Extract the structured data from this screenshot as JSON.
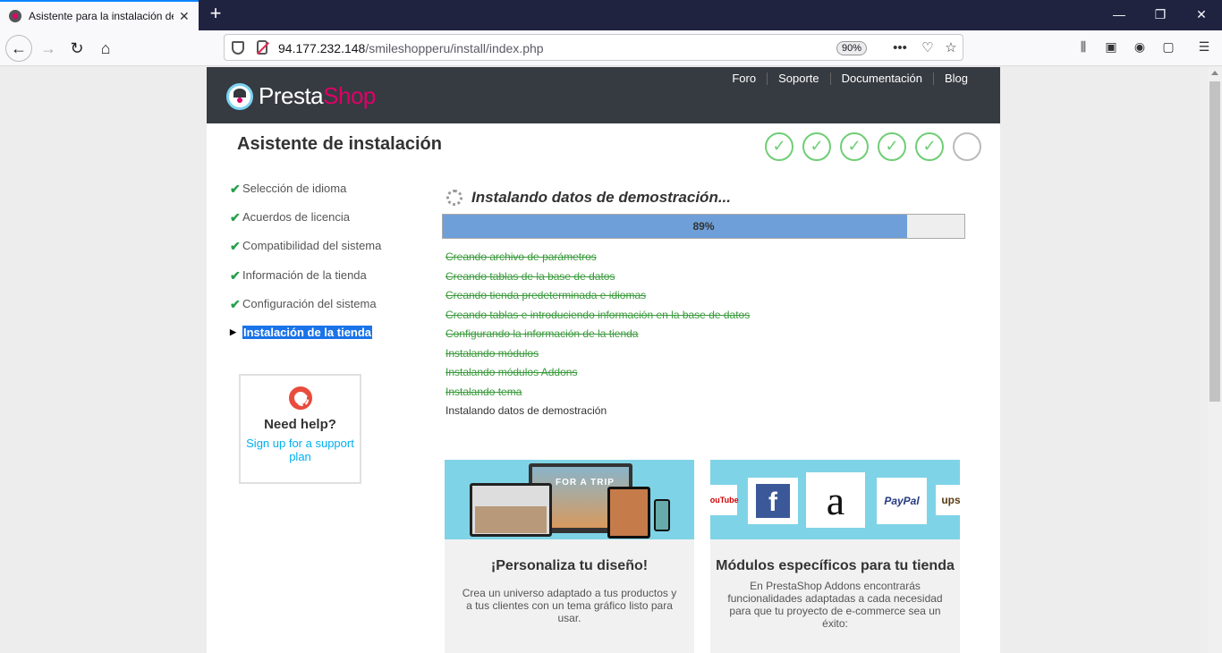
{
  "browser": {
    "tab_title": "Asistente para la instalación de",
    "url_host": "94.177.232.148",
    "url_path": "/smileshopperu/install/index.php",
    "zoom": "90%"
  },
  "header": {
    "logo_presta": "Presta",
    "logo_shop": "Shop",
    "nav": [
      "Foro",
      "Soporte",
      "Documentación",
      "Blog"
    ]
  },
  "wizard": {
    "title": "Asistente de instalación",
    "steps": [
      {
        "label": "Selección de idioma",
        "status": "done"
      },
      {
        "label": "Acuerdos de licencia",
        "status": "done"
      },
      {
        "label": "Compatibilidad del sistema",
        "status": "done"
      },
      {
        "label": "Información de la tienda",
        "status": "done"
      },
      {
        "label": "Configuración del sistema",
        "status": "done"
      },
      {
        "label": "Instalación de la tienda",
        "status": "active"
      }
    ],
    "completed_indicators": 5,
    "total_indicators": 6
  },
  "help": {
    "title": "Need help?",
    "link": "Sign up for a support plan"
  },
  "install": {
    "heading": "Instalando datos de demostración...",
    "progress_value": 89,
    "progress_label": "89%",
    "tasks": [
      {
        "label": "Creando archivo de parámetros",
        "status": "done"
      },
      {
        "label": "Creando tablas de la base de datos",
        "status": "done"
      },
      {
        "label": "Creando tienda predeterminada e idiomas",
        "status": "done"
      },
      {
        "label": "Creando tablas e introduciendo información en la base de datos",
        "status": "done"
      },
      {
        "label": "Configurando la información de la tienda",
        "status": "done"
      },
      {
        "label": "Instalando módulos",
        "status": "done"
      },
      {
        "label": "Instalando módulos Addons",
        "status": "done"
      },
      {
        "label": "Instalando tema",
        "status": "done"
      },
      {
        "label": "Instalando datos de demostración",
        "status": "current"
      }
    ]
  },
  "cards": [
    {
      "title": "¡Personaliza tu diseño!",
      "text": "Crea un universo adaptado a tus productos y a tus clientes con un tema gráfico listo para usar."
    },
    {
      "title": "Módulos específicos para tu tienda",
      "text": "En PrestaShop Addons encontrarás funcionalidades adaptadas a cada necesidad para que tu proyecto de e-commerce sea un éxito:"
    }
  ],
  "card_images": {
    "screen_caption": "FOR A TRIP",
    "logos": [
      "YouTube",
      "f",
      "a",
      "PayPal",
      "ups"
    ]
  },
  "colors": {
    "accent": "#df0067",
    "header_bg": "#363a41",
    "check": "#6fce75",
    "progress": "#6f9fd8"
  }
}
